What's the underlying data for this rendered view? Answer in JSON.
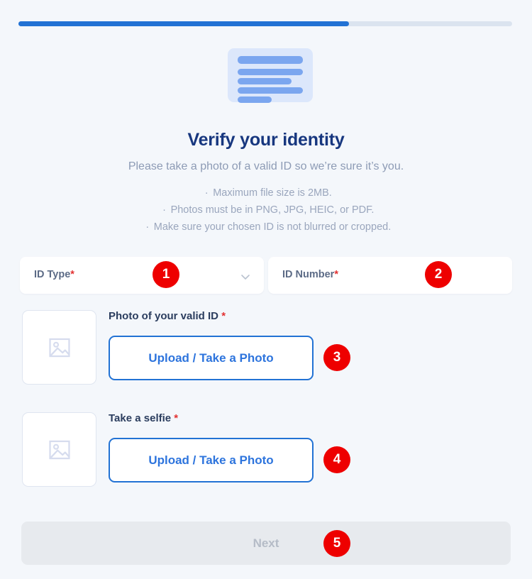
{
  "progress": {
    "percent": 67,
    "fill_color": "#2272d4",
    "track_color": "#dbe4ef"
  },
  "hero": {
    "icon_name": "id-document-icon",
    "icon_bg": "#dce7fb",
    "icon_line_color": "#7ba6ef"
  },
  "header": {
    "title": "Verify your identity",
    "subtitle": "Please take a photo of a valid ID so we’re sure it’s you."
  },
  "requirements": [
    "Maximum file size is 2MB.",
    "Photos must be in PNG, JPG, HEIC, or PDF.",
    "Make sure your chosen ID is not blurred or cropped."
  ],
  "bullet_glyph": "·",
  "form": {
    "id_type": {
      "label": "ID Type",
      "required_mark": "*",
      "value": "",
      "placeholder": "ID Type",
      "chevron_icon": "chevron-down-icon"
    },
    "id_number": {
      "label": "ID Number",
      "required_mark": "*",
      "value": "",
      "placeholder": "ID Number"
    },
    "photo_id": {
      "label": "Photo of your valid ID",
      "required_mark": "*",
      "button_label": "Upload / Take a Photo",
      "thumbnail_icon": "image-placeholder-icon"
    },
    "selfie": {
      "label": "Take a selfie",
      "required_mark": "*",
      "button_label": "Upload / Take a Photo",
      "thumbnail_icon": "image-placeholder-icon"
    },
    "next": {
      "label": "Next",
      "disabled": true
    }
  },
  "annotations": [
    {
      "number": "1"
    },
    {
      "number": "2"
    },
    {
      "number": "3"
    },
    {
      "number": "4"
    },
    {
      "number": "5"
    }
  ],
  "colors": {
    "page_bg": "#f4f7fb",
    "accent_blue": "#2272d4",
    "title_navy": "#17377f",
    "required_red": "#e23232",
    "badge_red": "#ee0000",
    "disabled_bg": "#e7eaee"
  }
}
